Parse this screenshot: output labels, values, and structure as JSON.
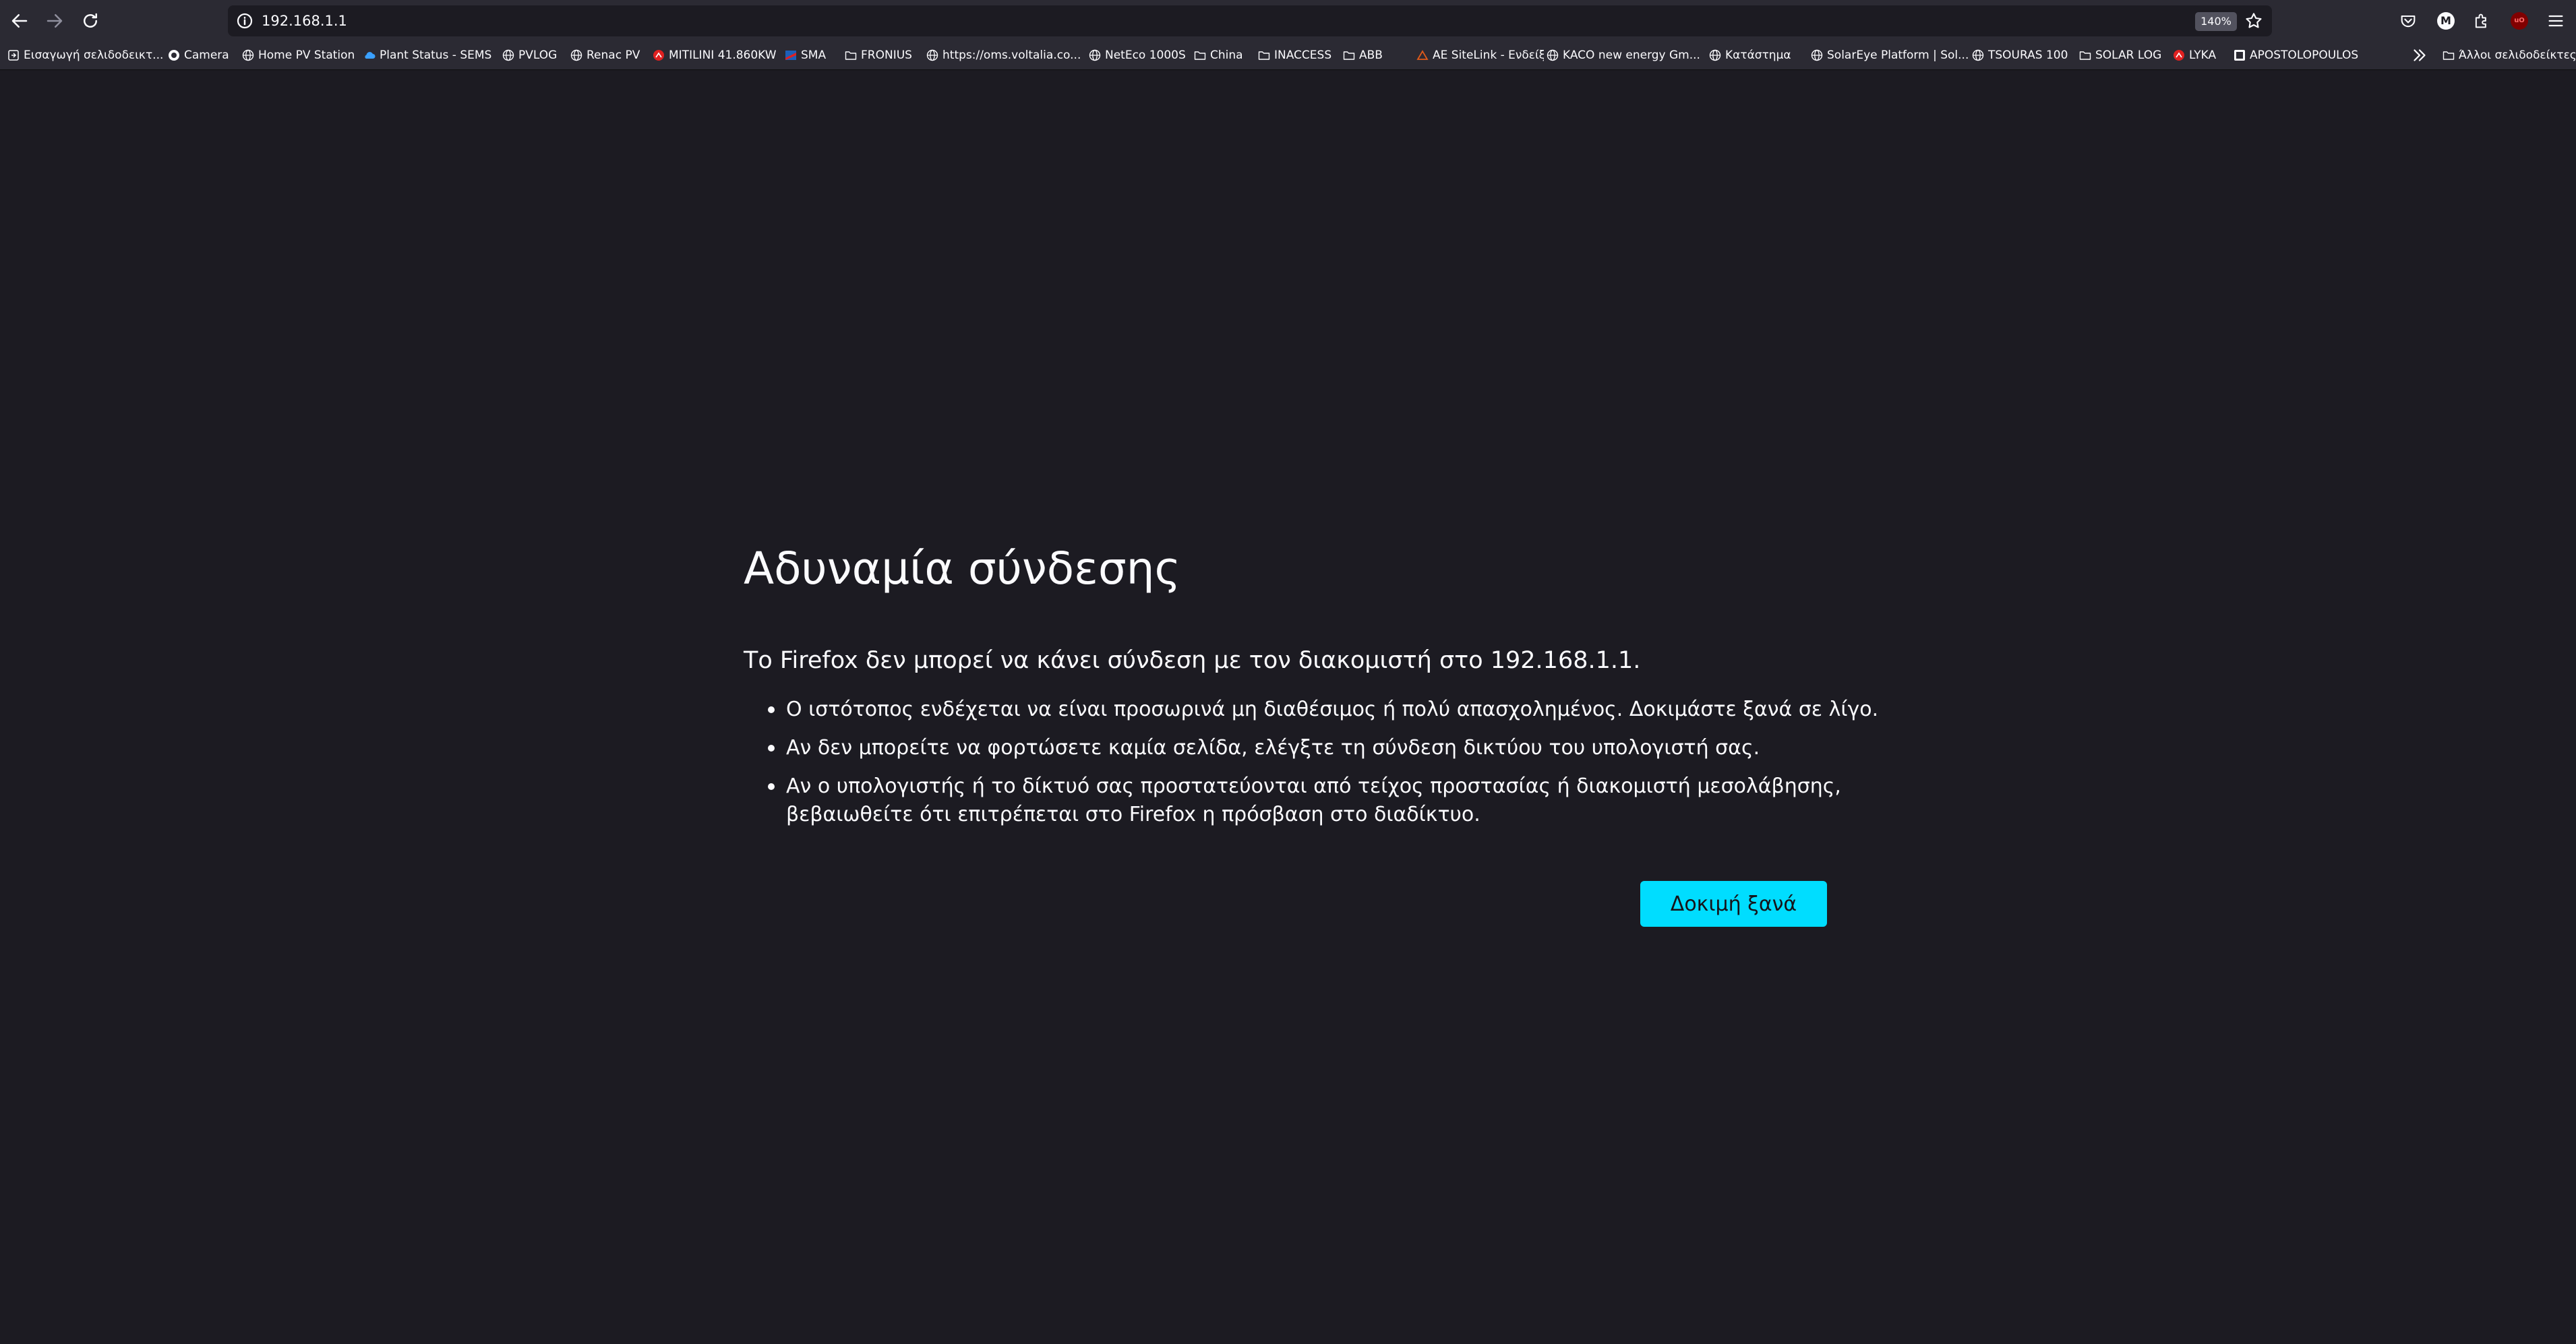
{
  "browser": {
    "url": "192.168.1.1",
    "zoom": "140%",
    "profile_initial": "M",
    "ublock_label": "uO"
  },
  "bookmarks": {
    "items": [
      {
        "label": "Εισαγωγή σελιδοδεικτ...",
        "icon": "import-icon"
      },
      {
        "label": "Camera",
        "icon": "camera-icon"
      },
      {
        "label": "Home PV Station",
        "icon": "globe-icon"
      },
      {
        "label": "Plant Status - SEMS",
        "icon": "cloud-icon"
      },
      {
        "label": "PVLOG",
        "icon": "globe-icon"
      },
      {
        "label": "Renac PV",
        "icon": "globe-icon"
      },
      {
        "label": "MITILINI 41.860KW",
        "icon": "red-logo-icon"
      },
      {
        "label": "SMA",
        "icon": "sma-logo-icon"
      },
      {
        "label": "FRONIUS",
        "icon": "folder-icon"
      },
      {
        "label": "https://oms.voltalia.co...",
        "icon": "globe-icon"
      },
      {
        "label": "NetEco 1000S",
        "icon": "globe-icon"
      },
      {
        "label": "China",
        "icon": "folder-icon"
      },
      {
        "label": "INACCESS",
        "icon": "folder-icon"
      },
      {
        "label": "ABB",
        "icon": "folder-icon"
      },
      {
        "label": "AE SiteLink - Ενδείξεις",
        "icon": "ae-logo-icon"
      },
      {
        "label": "KACO new energy Gm...",
        "icon": "globe-icon"
      },
      {
        "label": "Κατάστημα",
        "icon": "globe-icon"
      },
      {
        "label": "SolarEye Platform | Sol...",
        "icon": "globe-icon"
      },
      {
        "label": "TSOURAS 100",
        "icon": "globe-icon"
      },
      {
        "label": "SOLAR LOG",
        "icon": "folder-icon"
      },
      {
        "label": "LYKA",
        "icon": "red-logo-icon"
      },
      {
        "label": "APOSTOLOPOULOS",
        "icon": "site-logo-icon"
      }
    ],
    "other_label": "Άλλοι σελιδοδείκτες"
  },
  "error": {
    "title": "Αδυναμία σύνδεσης",
    "description": "Το Firefox δεν μπορεί να κάνει σύνδεση με τον διακομιστή στο 192.168.1.1.",
    "hints": [
      "Ο ιστότοπος ενδέχεται να είναι προσωρινά μη διαθέσιμος ή πολύ απασχολημένος. Δοκιμάστε ξανά σε λίγο.",
      "Αν δεν μπορείτε να φορτώσετε καμία σελίδα, ελέγξτε τη σύνδεση δικτύου του υπολογιστή σας.",
      "Αν ο υπολογιστής ή το δίκτυό σας προστατεύονται από τείχος προστασίας ή διακομιστή μεσολάβησης, βεβαιωθείτε ότι επιτρέπεται στο Firefox η πρόσβαση στο διαδίκτυο."
    ],
    "try_again_label": "Δοκιμή ξανά"
  },
  "colors": {
    "page_bg": "#1c1b22",
    "toolbar_bg": "#2b2a33",
    "accent": "#00ddff"
  }
}
